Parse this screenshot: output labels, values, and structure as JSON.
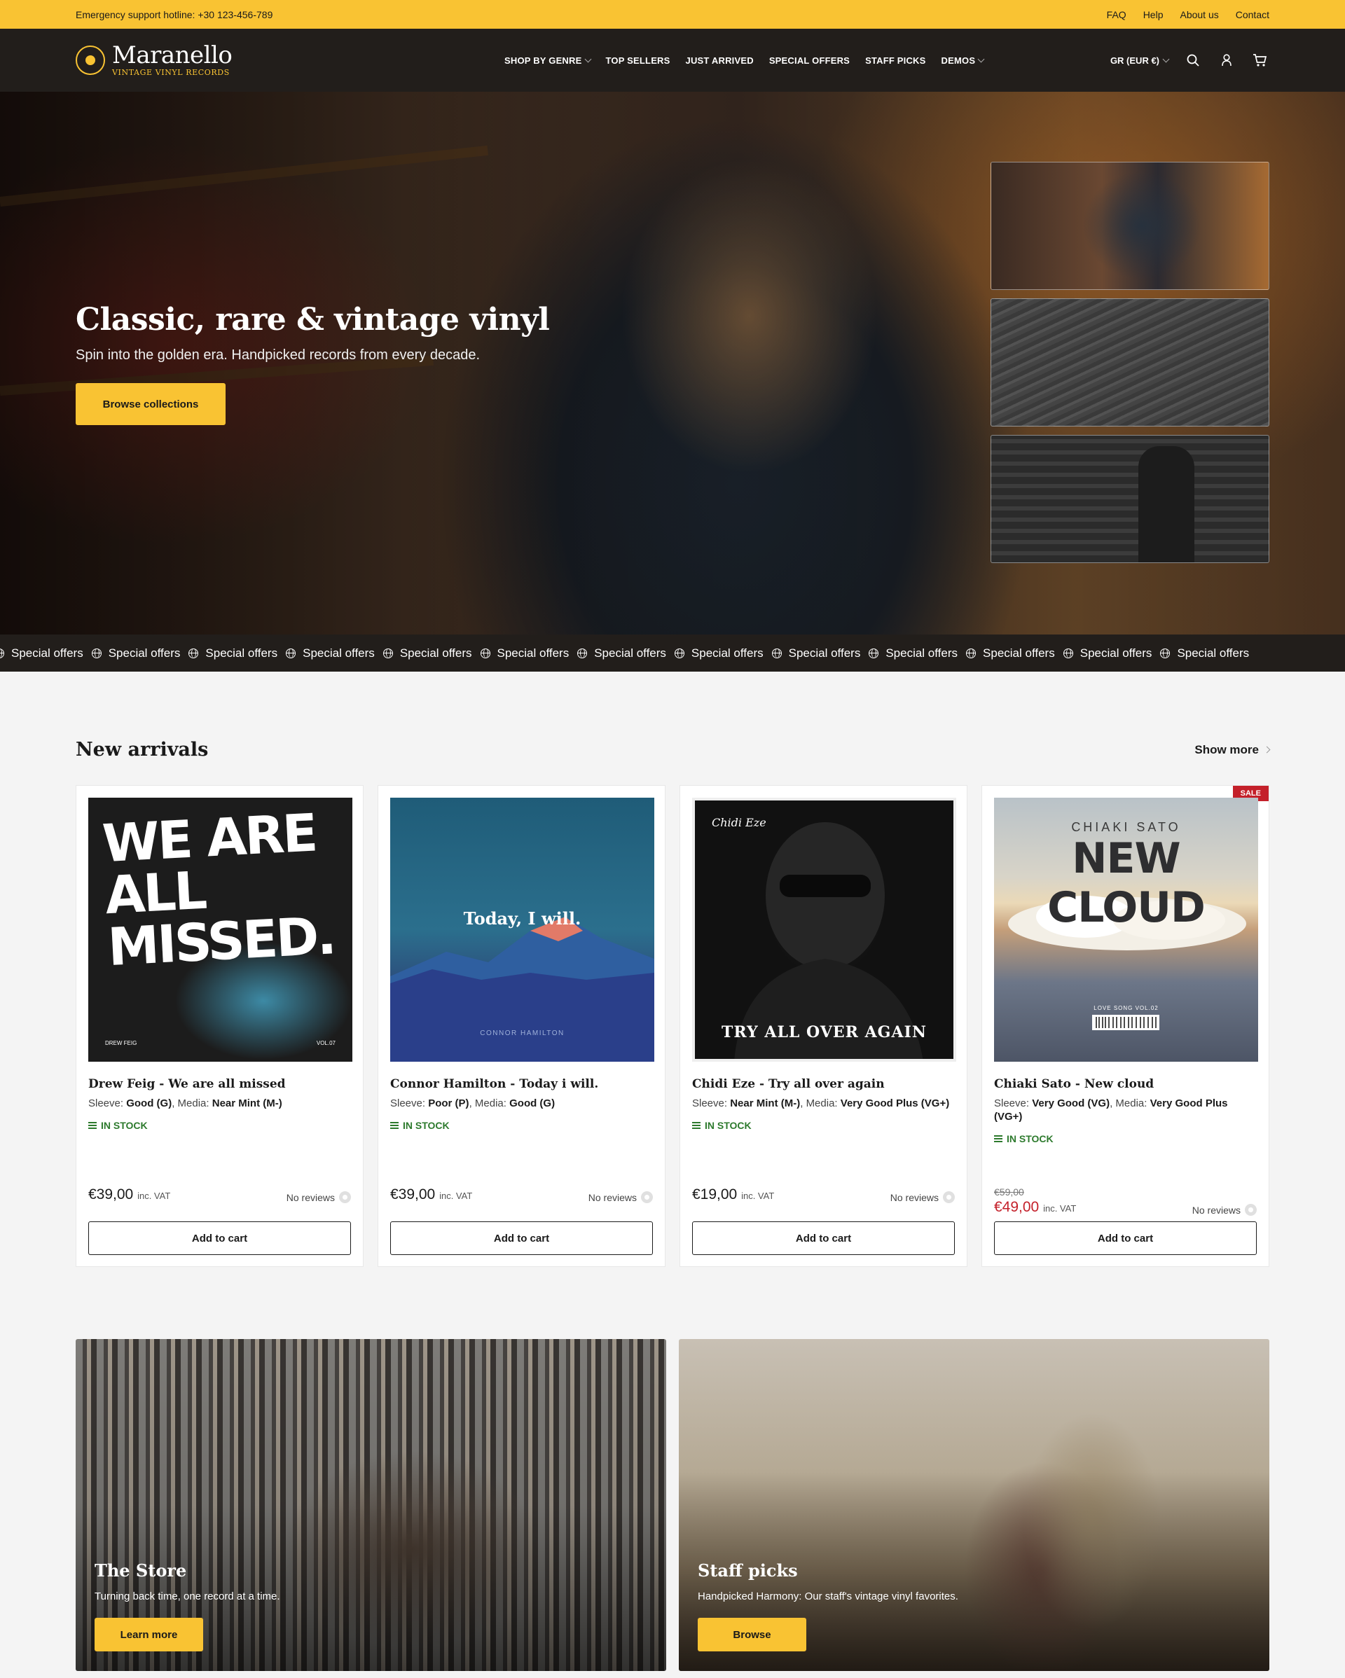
{
  "topbar": {
    "hotline": "Emergency support hotline: +30 123-456-789",
    "links": [
      "FAQ",
      "Help",
      "About us",
      "Contact"
    ]
  },
  "header": {
    "logo_name": "Maranello",
    "logo_tagline": "VINTAGE VINYL RECORDS",
    "nav": [
      {
        "label": "SHOP BY GENRE",
        "dropdown": true
      },
      {
        "label": "TOP SELLERS",
        "dropdown": false
      },
      {
        "label": "JUST ARRIVED",
        "dropdown": false
      },
      {
        "label": "SPECIAL OFFERS",
        "dropdown": false
      },
      {
        "label": "STAFF PICKS",
        "dropdown": false
      },
      {
        "label": "DEMOS",
        "dropdown": true
      }
    ],
    "currency": "GR (EUR €)",
    "icons": [
      "search-icon",
      "user-icon",
      "cart-icon"
    ]
  },
  "hero": {
    "title": "Classic, rare & vintage vinyl",
    "subtitle": "Spin into the golden era. Handpicked records from every decade.",
    "cta": "Browse collections"
  },
  "ticker": {
    "label": "Special offers",
    "repeat": 13
  },
  "arrivals": {
    "title": "New arrivals",
    "show_more": "Show more",
    "products": [
      {
        "cover_text": "WE ARE ALL MISSED.",
        "cover_sub_left": "DREW FEIG",
        "cover_sub_right": "VOL.07",
        "title": "Drew Feig - We are all missed",
        "sleeve": "Good (G)",
        "media": "Near Mint (M-)",
        "stock": "IN STOCK",
        "price": "€39,00",
        "old_price": "",
        "vat": "inc. VAT",
        "reviews": "No reviews",
        "sale": false,
        "button": "Add to cart"
      },
      {
        "cover_text": "Today, I will.",
        "cover_sub_left": "CONNOR HAMILTON",
        "cover_sub_right": "",
        "title": "Connor Hamilton - Today i will.",
        "sleeve": "Poor (P)",
        "media": "Good (G)",
        "stock": "IN STOCK",
        "price": "€39,00",
        "old_price": "",
        "vat": "inc. VAT",
        "reviews": "No reviews",
        "sale": false,
        "button": "Add to cart"
      },
      {
        "cover_text": "TRY ALL OVER AGAIN",
        "cover_sub_left": "Chidi Eze",
        "cover_sub_right": "",
        "title": "Chidi Eze - Try all over again",
        "sleeve": "Near Mint (M-)",
        "media": "Very Good Plus (VG+)",
        "stock": "IN STOCK",
        "price": "€19,00",
        "old_price": "",
        "vat": "inc. VAT",
        "reviews": "No reviews",
        "sale": false,
        "button": "Add to cart"
      },
      {
        "cover_text": "NEW CLOUD",
        "cover_sub_left": "CHIAKI SATO",
        "cover_sub_right": "LOVE SONG VOL.02",
        "title": "Chiaki Sato - New cloud",
        "sleeve": "Very Good (VG)",
        "media": "Very Good Plus (VG+)",
        "stock": "IN STOCK",
        "price": "€49,00",
        "old_price": "€59,00",
        "vat": "inc. VAT",
        "reviews": "No reviews",
        "sale": true,
        "sale_label": "SALE",
        "button": "Add to cart"
      }
    ],
    "sleeve_label": "Sleeve:",
    "media_label": "Media:"
  },
  "promos": [
    {
      "title": "The Store",
      "subtitle": "Turning back time, one record at a time.",
      "button": "Learn more"
    },
    {
      "title": "Staff picks",
      "subtitle": "Handpicked Harmony: Our staff's vintage vinyl favorites.",
      "button": "Browse"
    }
  ],
  "colors": {
    "accent": "#f9c333",
    "dark": "#221e1b",
    "sale": "#c4202a",
    "stock": "#2d7a2d"
  }
}
